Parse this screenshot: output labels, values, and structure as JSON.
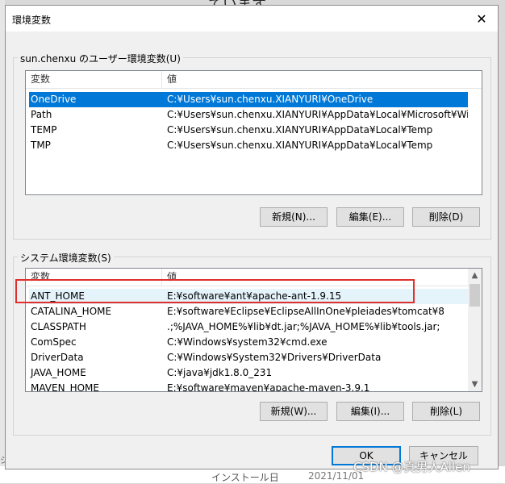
{
  "background": {
    "top_text": "ています",
    "bottom_text": "インストール日",
    "bottom_date": "2021/11/01",
    "bottom_left": "ジ"
  },
  "dialog": {
    "title": "環境変数",
    "close_glyph": "✕"
  },
  "user_vars": {
    "group_label": "sun.chenxu のユーザー環境変数(U)",
    "columns": [
      "変数",
      "値"
    ],
    "rows": [
      {
        "name": "OneDrive",
        "value": "C:¥Users¥sun.chenxu.XIANYURI¥OneDrive",
        "selected": true
      },
      {
        "name": "Path",
        "value": "C:¥Users¥sun.chenxu.XIANYURI¥AppData¥Local¥Microsoft¥Windo..."
      },
      {
        "name": "TEMP",
        "value": "C:¥Users¥sun.chenxu.XIANYURI¥AppData¥Local¥Temp"
      },
      {
        "name": "TMP",
        "value": "C:¥Users¥sun.chenxu.XIANYURI¥AppData¥Local¥Temp"
      }
    ],
    "buttons": {
      "new": "新規(N)...",
      "edit": "編集(E)...",
      "delete": "削除(D)"
    }
  },
  "system_vars": {
    "group_label": "システム環境変数(S)",
    "columns": [
      "変数",
      "値"
    ],
    "rows": [
      {
        "name": "ANT_HOME",
        "value": "E:¥software¥ant¥apache-ant-1.9.15",
        "hover": true
      },
      {
        "name": "CATALINA_HOME",
        "value": "E:¥software¥Eclipse¥EclipseAllInOne¥pleiades¥tomcat¥8"
      },
      {
        "name": "CLASSPATH",
        "value": ".;%JAVA_HOME%¥lib¥dt.jar;%JAVA_HOME%¥lib¥tools.jar;"
      },
      {
        "name": "ComSpec",
        "value": "C:¥Windows¥system32¥cmd.exe"
      },
      {
        "name": "DriverData",
        "value": "C:¥Windows¥System32¥Drivers¥DriverData"
      },
      {
        "name": "JAVA_HOME",
        "value": "C:¥java¥jdk1.8.0_231"
      },
      {
        "name": "MAVEN_HOME",
        "value": "E:¥software¥maven¥apache-maven-3.9.1"
      }
    ],
    "buttons": {
      "new": "新規(W)...",
      "edit": "編集(I)...",
      "delete": "削除(L)"
    },
    "scroll_up_glyph": "▲",
    "scroll_down_glyph": "▼"
  },
  "footer": {
    "ok": "OK",
    "cancel": "キャンセル"
  },
  "watermark": "CSDN @真男人Allen",
  "colors": {
    "selection": "#0078d7",
    "highlight_border": "#e0302d"
  }
}
